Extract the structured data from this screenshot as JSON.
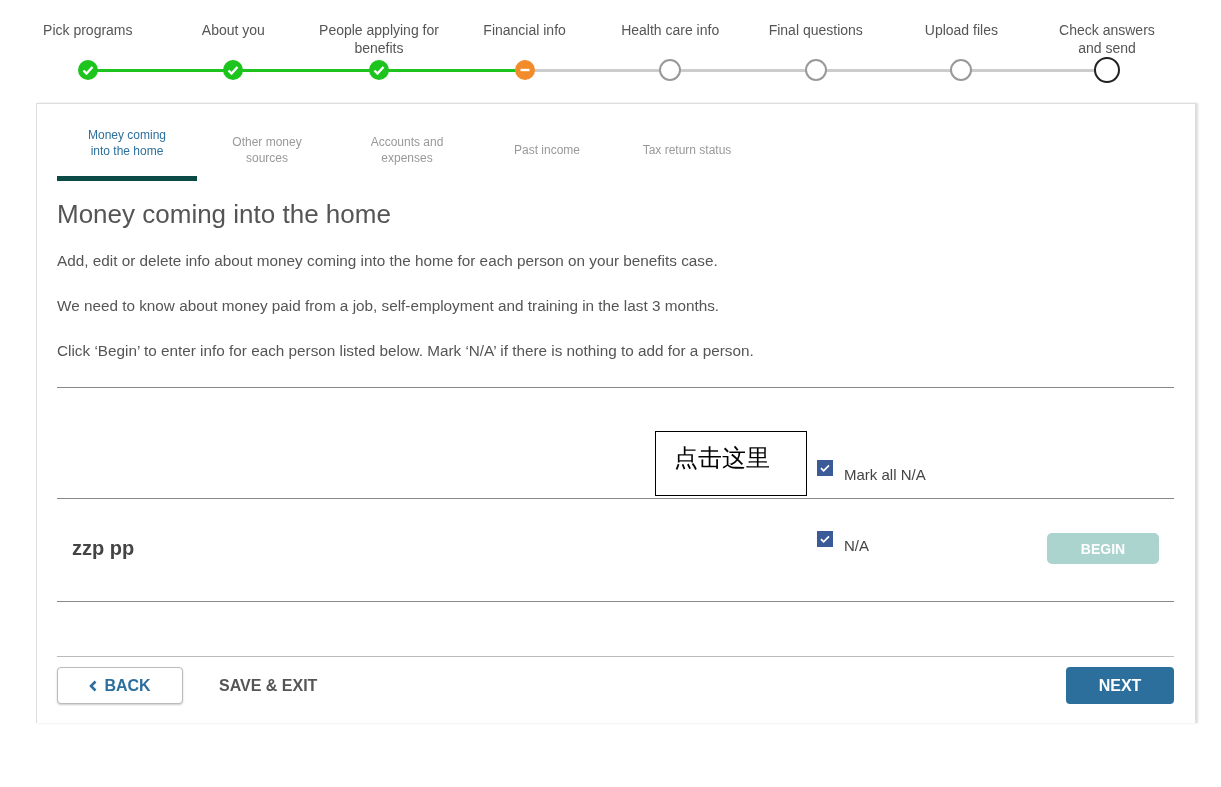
{
  "steps": [
    {
      "label": "Pick programs",
      "kind": "done"
    },
    {
      "label": "About you",
      "kind": "done"
    },
    {
      "label": "People applying for benefits",
      "kind": "done"
    },
    {
      "label": "Financial info",
      "kind": "current"
    },
    {
      "label": "Health care info",
      "kind": "todo"
    },
    {
      "label": "Final questions",
      "kind": "todo"
    },
    {
      "label": "Upload files",
      "kind": "todo"
    },
    {
      "label": "Check answers and send",
      "kind": "final"
    }
  ],
  "tabs": [
    {
      "label": "Money coming into the home",
      "selected": true
    },
    {
      "label": "Other money sources",
      "selected": false
    },
    {
      "label": "Accounts and expenses",
      "selected": false
    },
    {
      "label": "Past income",
      "selected": false
    },
    {
      "label": "Tax return status",
      "selected": false
    }
  ],
  "heading": "Money coming into the home",
  "paragraphs": [
    "Add, edit or delete info about money coming into the home for each person on your benefits case.",
    "We need to know about money paid from a job, self-employment and training in the last 3 months.",
    "Click ‘Begin’ to enter info for each person listed below. Mark ‘N/A’ if there is nothing to add for a person."
  ],
  "annotation": "点击这里",
  "mark_all": {
    "label": "Mark all N/A",
    "checked": true
  },
  "people": [
    {
      "name": "zzp pp",
      "na_label": "N/A",
      "checked": true,
      "button": "BEGIN",
      "disabled": true
    }
  ],
  "footer": {
    "back": "BACK",
    "save_exit": "SAVE & EXIT",
    "next": "NEXT"
  }
}
